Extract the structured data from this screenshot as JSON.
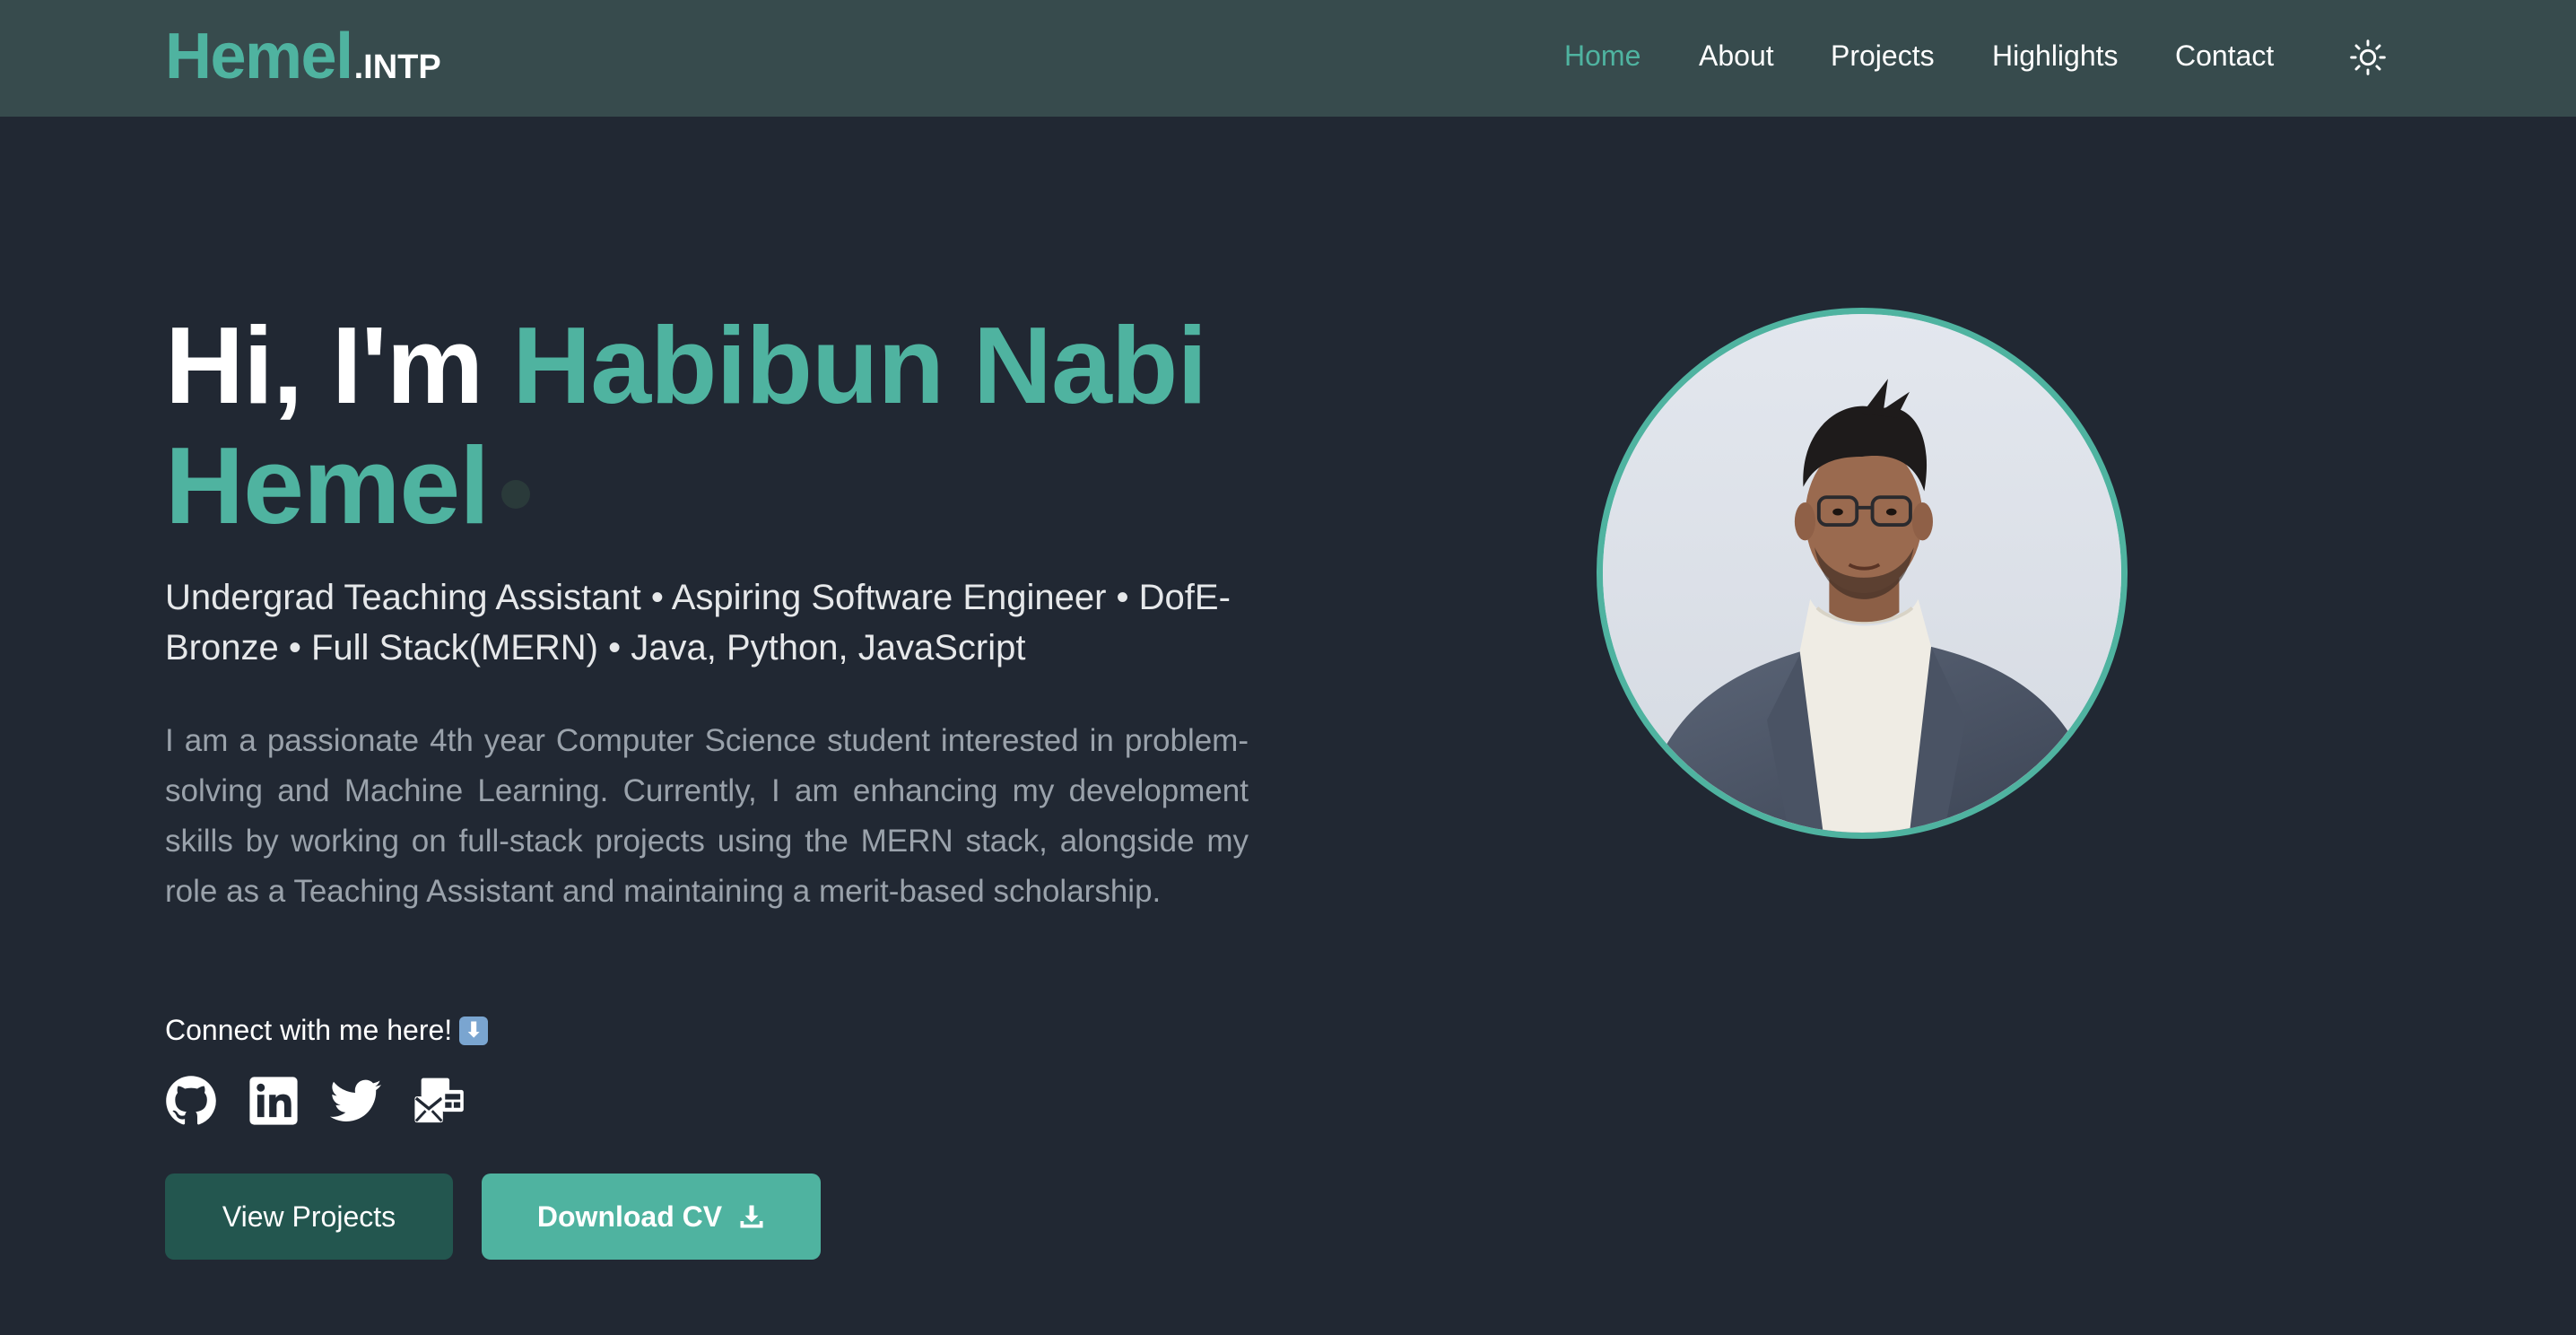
{
  "brand": {
    "main": "Hemel",
    "sub": ".INTP"
  },
  "nav": {
    "home": "Home",
    "about": "About",
    "projects": "Projects",
    "highlights": "Highlights",
    "contact": "Contact",
    "theme_icon": "sun-icon"
  },
  "hero": {
    "greeting": "Hi, I'm",
    "name_line1": "Habibun Nabi",
    "name_line2": "Hemel",
    "roles": "Undergrad Teaching Assistant • Aspiring Software Engineer • DofE-Bronze • Full Stack(MERN) • Java, Python, JavaScript",
    "about": "I am a passionate 4th year Computer Science student interested in problem-solving and Machine Learning. Currently, I am enhancing my development skills by working on full-stack projects using the MERN stack, alongside my role as a Teaching Assistant and maintaining a merit-based scholarship.",
    "connect_label": "Connect with me here!",
    "connect_emoji": "⬇",
    "socials": [
      "github-icon",
      "linkedin-icon",
      "twitter-icon",
      "mail-icon"
    ],
    "view_projects_label": "View Projects",
    "download_cv_label": "Download CV"
  },
  "colors": {
    "accent": "#4fb3a0",
    "navbar_bg": "#374b4d",
    "page_bg": "#212833",
    "dark_button": "#23564f"
  }
}
